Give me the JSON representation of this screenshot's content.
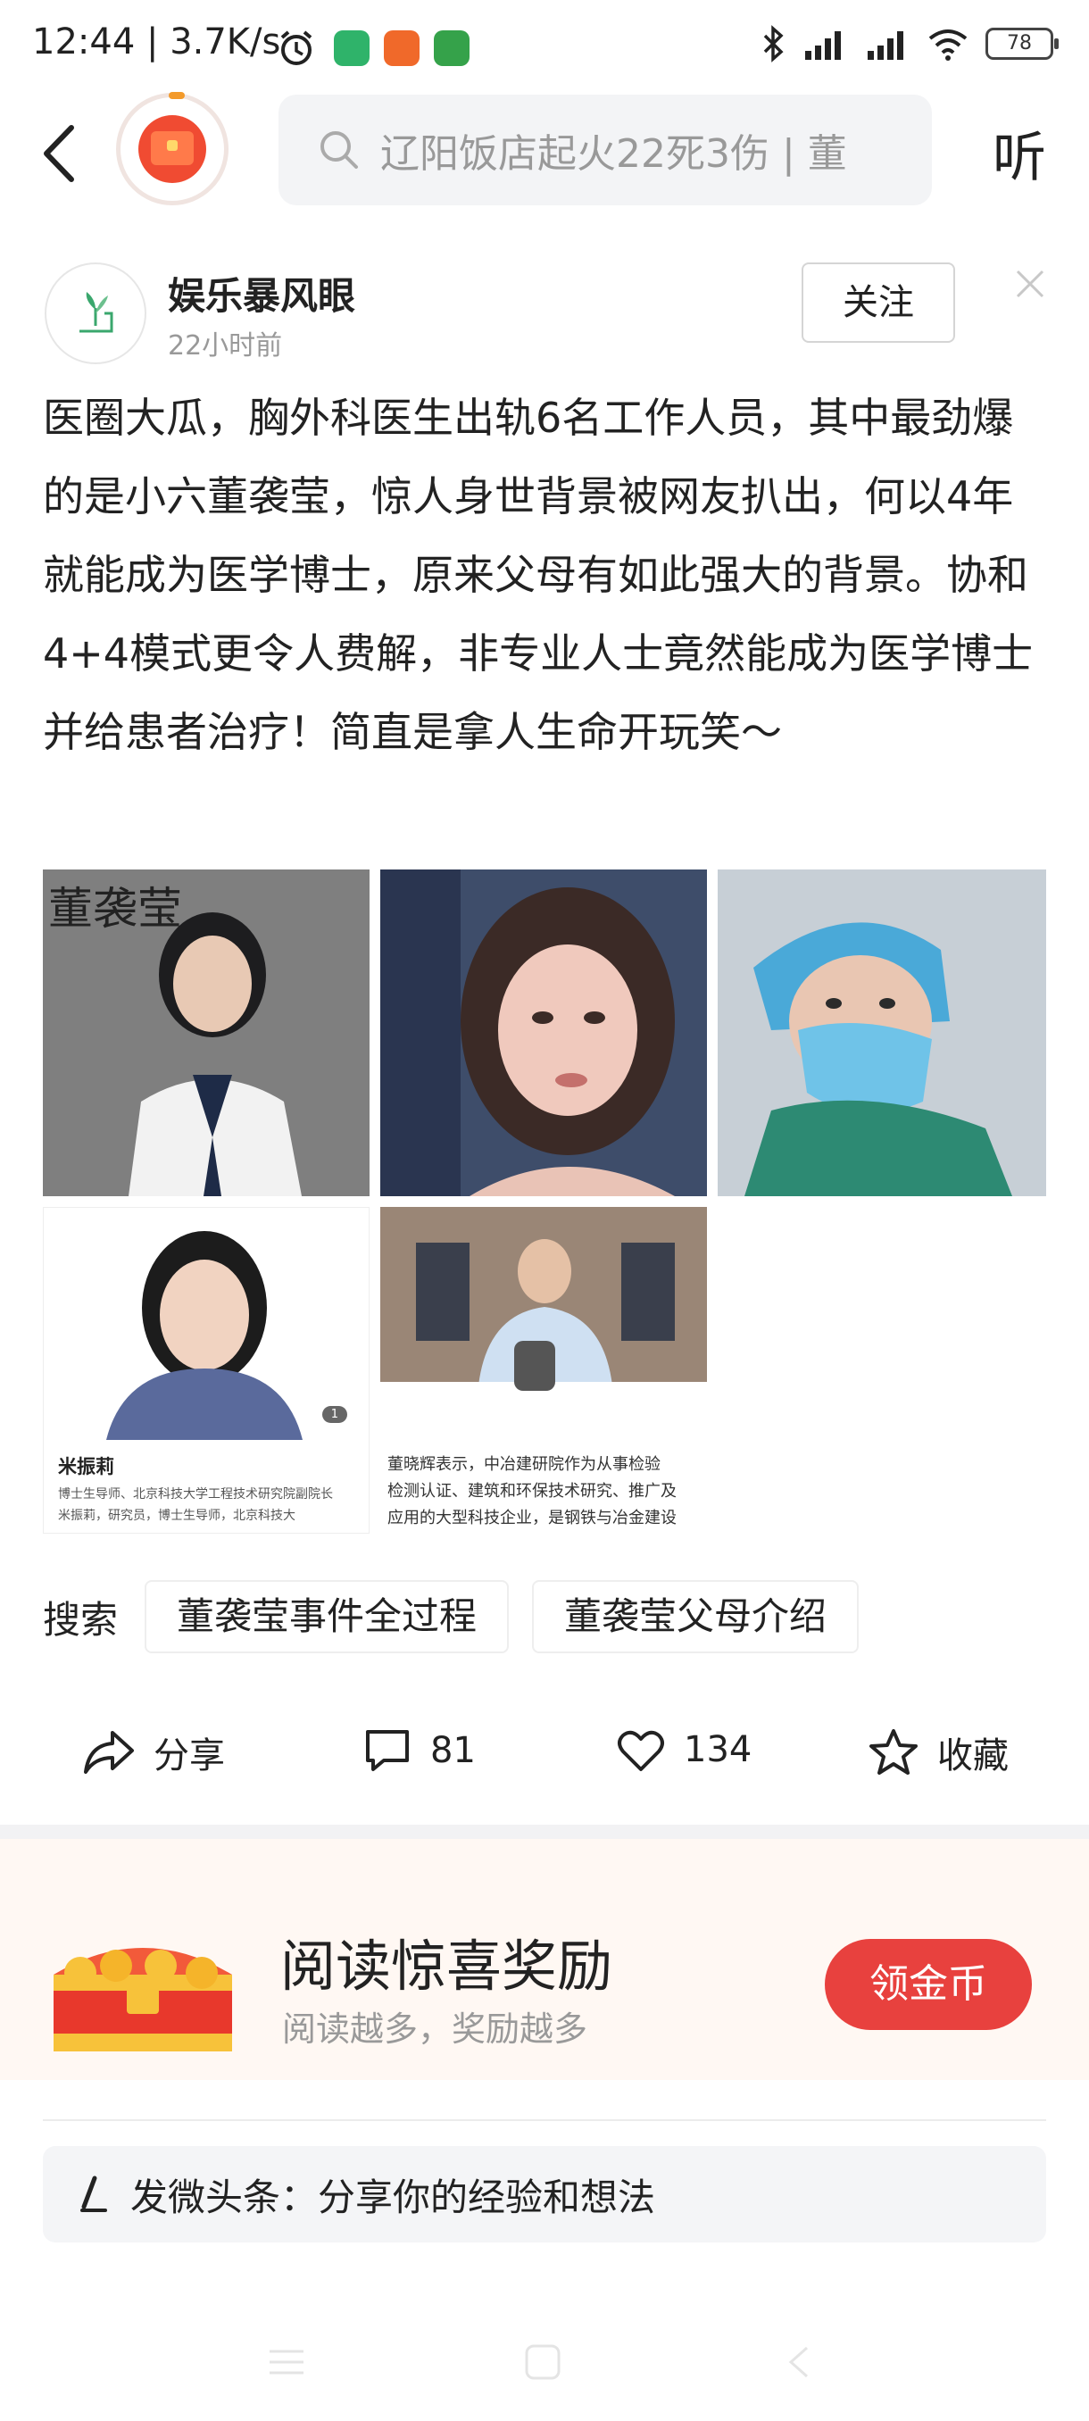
{
  "status_bar": {
    "time": "12:44",
    "net_speed": "3.7K/s",
    "battery": "78"
  },
  "nav": {
    "search_placeholder": "辽阳饭店起火22死3伤 | 董",
    "listen_label": "听"
  },
  "author": {
    "name": "娱乐暴风眼",
    "time": "22小时前",
    "follow_label": "关注"
  },
  "post": {
    "text": "医圈大瓜，胸外科医生出轨6名工作人员，其中最劲爆的是小六董袭莹，惊人身世背景被网友扒出，何以4年就能成为医学博士，原来父母有如此强大的背景。协和4+4模式更令人费解，非专业人士竟然能成为医学博士并给患者治疗！简直是拿人生命开玩笑～"
  },
  "images": {
    "img1_caption": "董袭莹",
    "card": {
      "name": "米振莉",
      "count": "1",
      "line1": "博士生导师、北京科技大学工程技术研究院副院长",
      "line2": "米振莉，研究员，博士生导师，北京科技大"
    },
    "news": {
      "line1": "董晓辉表示，中冶建研院作为从事检验",
      "line2": "检测认证、建筑和环保技术研究、推广及",
      "line3": "应用的大型科技企业，是钢铁与冶金建设"
    }
  },
  "search": {
    "label": "搜索",
    "chips": [
      "董袭莹事件全过程",
      "董袭莹父母介绍"
    ]
  },
  "actions": {
    "share": "分享",
    "comments": "81",
    "likes": "134",
    "favorite": "收藏"
  },
  "reward": {
    "title": "阅读惊喜奖励",
    "subtitle": "阅读越多，奖励越多",
    "button": "领金币"
  },
  "composer": {
    "placeholder": "发微头条：分享你的经验和想法"
  },
  "colors": {
    "accent_red": "#e8413e",
    "reward_bg": "#fff8f3"
  }
}
